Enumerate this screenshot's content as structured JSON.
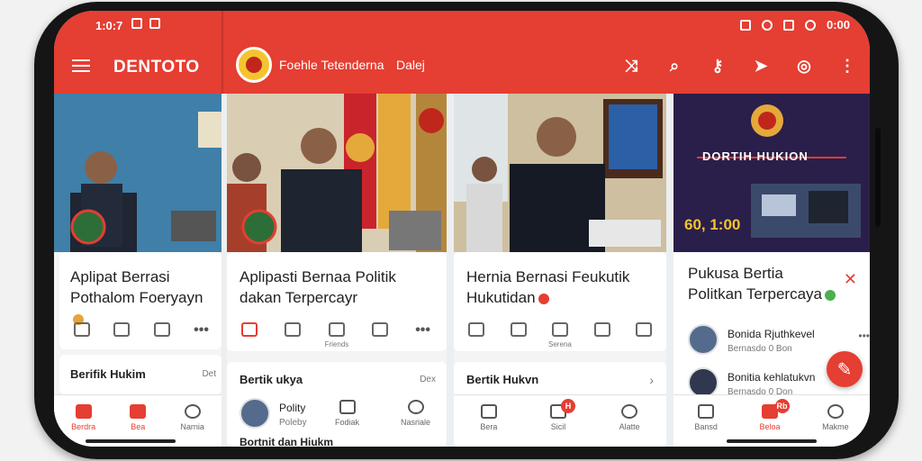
{
  "status_bar": {
    "time": "1:0:7",
    "right_time": "0:00"
  },
  "app": {
    "title": "DENTOTO",
    "org_name": "Foehle Tetenderna",
    "org_tag": "Dalej"
  },
  "panel1": {
    "headline": "Aplipat Berrasi Pothalom Foeryayn",
    "section": "Berifik Hukim",
    "section_aux": "Det"
  },
  "panel2": {
    "headline": "Aplipasti Bernaa Politik dakan Terpercayr",
    "action_label": "Friends",
    "section": "Bertik ukya",
    "section_aux": "Dex",
    "list": [
      {
        "name": "Polity",
        "meta": "Poleby"
      },
      {
        "name": "Bortnit dan Hiukm",
        "meta": ""
      }
    ],
    "nav": [
      "Polity",
      "Fodiak",
      "Nasriale"
    ]
  },
  "panel3": {
    "headline": "Hernia Bernasi Feukutik Hukutidan",
    "action_label": "Serena",
    "section": "Bertik Hukvn",
    "nav": [
      "Bera",
      "Sicil",
      "Alatte"
    ],
    "badge": "H"
  },
  "panel4": {
    "slide_title": "DORTIH HUKION",
    "slide_count": "60, 1:00",
    "headline": "Pukusa Bertia Politkan Terpercaya",
    "list": [
      {
        "name": "Bonida Rjuthkevel",
        "meta": "Bernasdo 0 Bon"
      },
      {
        "name": "Bonitia kehlatukvn",
        "meta": "Bernasdo 0 Don"
      }
    ],
    "nav": [
      "Bansd",
      "Beloa",
      "Makme"
    ],
    "badge": "Rb"
  },
  "nav_panel1": [
    "Berdra",
    "Bea",
    "Narnia"
  ],
  "colors": {
    "brand": "#e53e32",
    "dark_appbar_divider": "#c7342a"
  }
}
